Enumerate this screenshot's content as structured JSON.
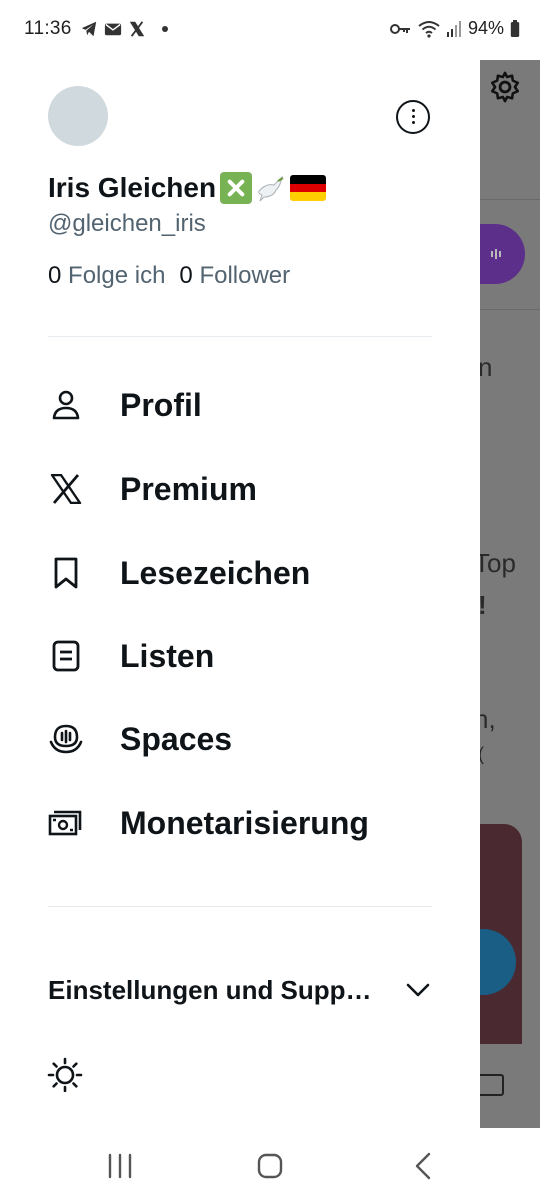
{
  "status_bar": {
    "time": "11:36",
    "battery": "94%",
    "left_icons": [
      "telegram-icon",
      "mail-icon",
      "x-icon",
      "dot-icon"
    ],
    "right_icons": [
      "vpn-key-icon",
      "wifi-icon",
      "signal-icon",
      "battery-icon"
    ]
  },
  "profile": {
    "display_name": "Iris Gleichen",
    "name_emoji": [
      "cross-mark-emoji",
      "dove-emoji",
      "germany-flag-emoji"
    ],
    "handle": "@gleichen_iris",
    "following_count": "0",
    "following_label": "Folge ich",
    "followers_count": "0",
    "followers_label": "Follower"
  },
  "menu": {
    "items": [
      {
        "label": "Profil",
        "icon": "person-icon"
      },
      {
        "label": "Premium",
        "icon": "x-logo-icon"
      },
      {
        "label": "Lesezeichen",
        "icon": "bookmark-icon"
      },
      {
        "label": "Listen",
        "icon": "list-icon"
      },
      {
        "label": "Spaces",
        "icon": "spaces-icon"
      },
      {
        "label": "Monetarisierung",
        "icon": "money-icon"
      }
    ]
  },
  "settings": {
    "label": "Einstellungen und Supp…",
    "icon": "chevron-down-icon"
  },
  "background": {
    "text_fragments": [
      "n",
      "Top",
      "!",
      "n,",
      "("
    ]
  },
  "colors": {
    "text_primary": "#0f1419",
    "text_secondary": "#536471",
    "avatar": "#cfd9de",
    "divider": "#e6ecf0",
    "overlay": "#7a7a7a"
  }
}
